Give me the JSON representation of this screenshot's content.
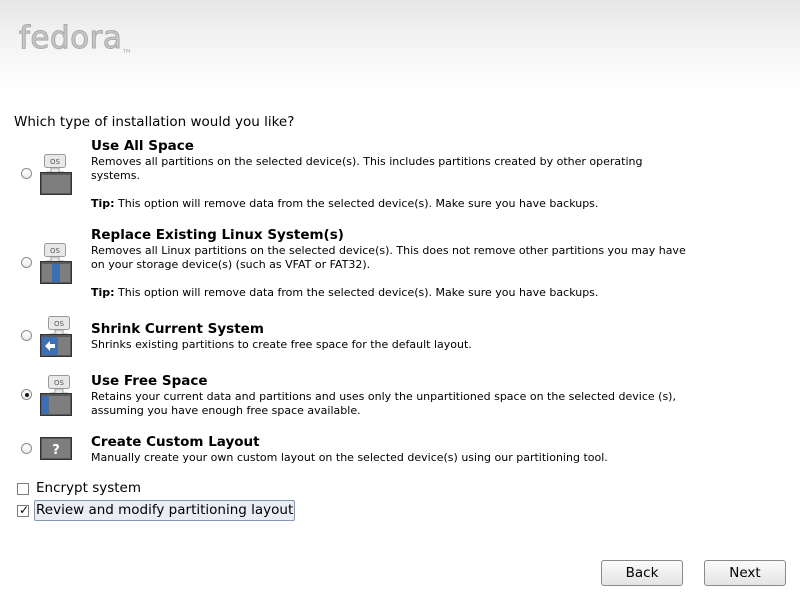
{
  "branding": {
    "logo_text": "fedora",
    "logo_mark": "TM"
  },
  "question": "Which type of installation would you like?",
  "options": [
    {
      "title": "Use All Space",
      "description": "Removes all partitions on the selected device(s).  This includes partitions created by other operating systems.",
      "tip_label": "Tip:",
      "tip_text": " This option will remove data from the selected device(s).  Make sure you have backups.",
      "icon": "disk-all-space-icon",
      "selected": false
    },
    {
      "title": "Replace Existing Linux System(s)",
      "description": "Removes all Linux partitions on the selected device(s). This does not remove other partitions you may have on your storage device(s) (such as VFAT or FAT32).",
      "tip_label": "Tip:",
      "tip_text": " This option will remove data from the selected device(s).  Make sure you have backups.",
      "icon": "disk-replace-linux-icon",
      "selected": false
    },
    {
      "title": "Shrink Current System",
      "description": "Shrinks existing partitions to create free space for the default layout.",
      "icon": "disk-shrink-icon",
      "selected": false
    },
    {
      "title": "Use Free Space",
      "description": "Retains your current data and partitions and uses only the unpartitioned space on the selected device (s), assuming you have enough free space available.",
      "icon": "disk-free-space-icon",
      "selected": true
    },
    {
      "title": "Create Custom Layout",
      "description": "Manually create your own custom layout on the selected device(s) using our partitioning tool.",
      "icon": "disk-custom-layout-icon",
      "selected": false
    }
  ],
  "icon_os_label": "OS",
  "icon_custom_glyph": "?",
  "checkboxes": {
    "encrypt": {
      "label": "Encrypt system",
      "checked": false
    },
    "review": {
      "label": "Review and modify partitioning layout",
      "checked": true,
      "check_glyph": "✓"
    }
  },
  "buttons": {
    "back": "Back",
    "next": "Next"
  },
  "colors": {
    "disk_dark": "#4a4a4a",
    "disk_light": "#7a7a7a",
    "accent_blue": "#3c6fb4"
  }
}
